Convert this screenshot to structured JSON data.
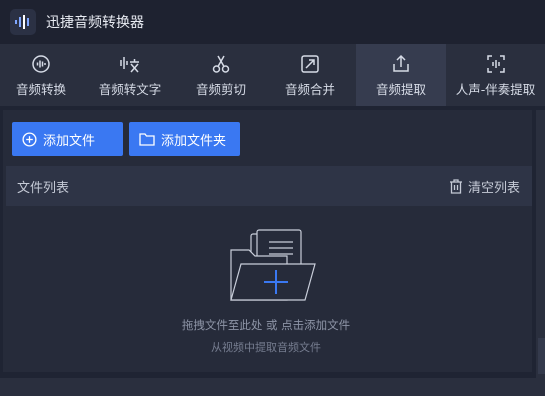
{
  "app": {
    "title": "迅捷音频转换器"
  },
  "tabs": [
    {
      "label": "音频转换",
      "icon": "audio-convert-icon"
    },
    {
      "label": "音频转文字",
      "icon": "speech-to-text-icon"
    },
    {
      "label": "音频剪切",
      "icon": "scissors-icon"
    },
    {
      "label": "音频合并",
      "icon": "merge-icon"
    },
    {
      "label": "音频提取",
      "icon": "extract-icon",
      "active": true
    },
    {
      "label": "人声-伴奏提取",
      "icon": "vocal-extract-icon"
    }
  ],
  "actions": {
    "add_file": "添加文件",
    "add_folder": "添加文件夹"
  },
  "file_list": {
    "title": "文件列表",
    "clear": "清空列表"
  },
  "drop_zone": {
    "hint": "拖拽文件至此处 或 点击添加文件",
    "sub_hint": "从视频中提取音频文件"
  },
  "colors": {
    "accent": "#3a78f2",
    "background": "#1f2433",
    "toolbar": "#2a2f3e",
    "active_tab": "#363c4f"
  }
}
